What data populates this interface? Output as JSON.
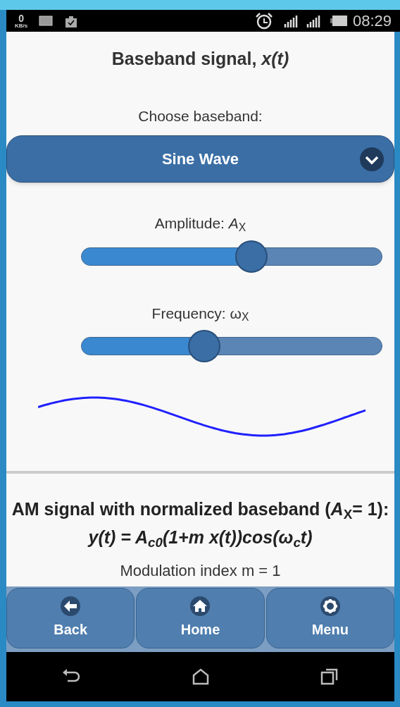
{
  "status_bar": {
    "speed": "0",
    "speed_unit": "KB/s",
    "time": "08:29"
  },
  "title": "Baseband signal, *x(t)*",
  "baseband": {
    "label": "Choose baseband:",
    "value": "Sine Wave"
  },
  "sliders": [
    {
      "label": "Amplitude: *A*$_{X}$",
      "level": 0.565
    },
    {
      "label": "Frequency: ω$_{X}$",
      "level": 0.41
    }
  ],
  "am_section": {
    "heading": "AM signal with normalized baseband (*A*$_{X}$= 1):",
    "formula": "y(t) = A$_{c0}$(1+m x(t))cos(ω$_{c}$t)"
  },
  "modulation_label": "Modulation index m = 1",
  "nav_buttons": [
    {
      "kind": "back",
      "label": "Back"
    },
    {
      "kind": "home",
      "label": "Home"
    },
    {
      "kind": "settings",
      "label": "Menu"
    }
  ]
}
